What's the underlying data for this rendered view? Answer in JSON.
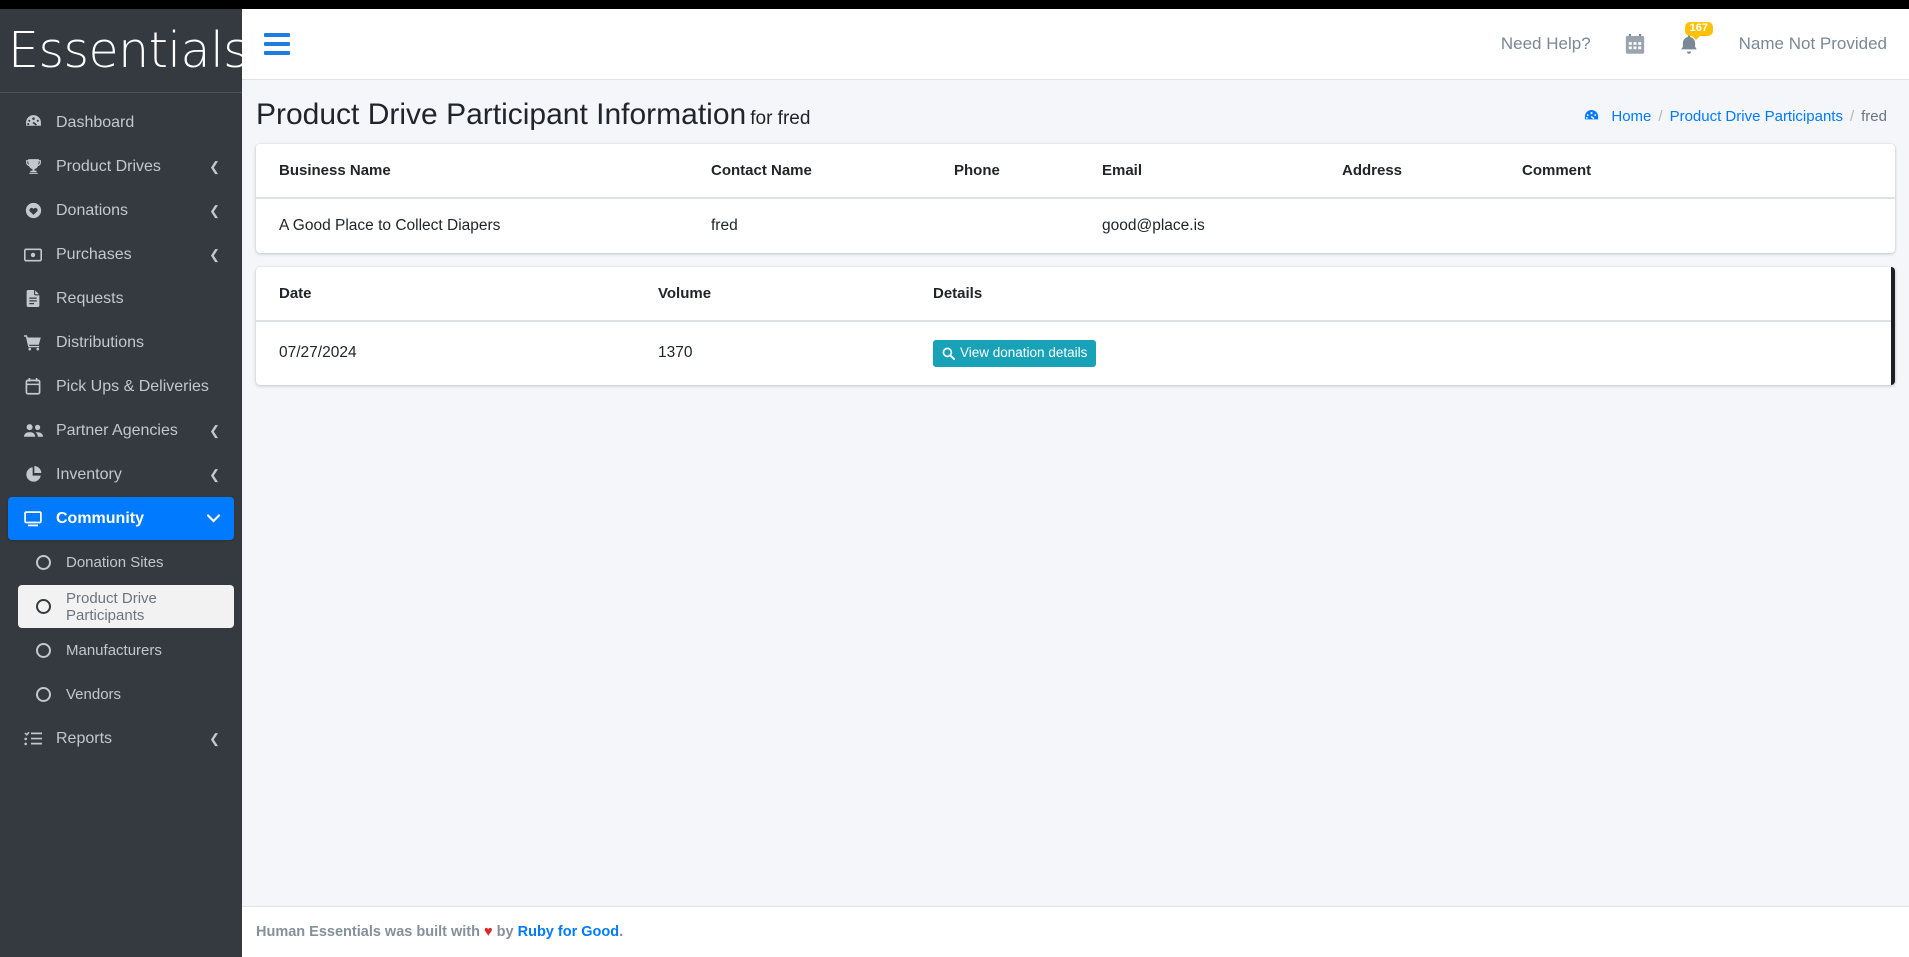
{
  "brand": {
    "name": "Essentials"
  },
  "sidebar": {
    "items": [
      {
        "label": "Dashboard",
        "icon": "dashboard-icon",
        "caret": false,
        "state": "normal"
      },
      {
        "label": "Product Drives",
        "icon": "trophy-icon",
        "caret": true,
        "state": "normal"
      },
      {
        "label": "Donations",
        "icon": "heart-circle-icon",
        "caret": true,
        "state": "normal"
      },
      {
        "label": "Purchases",
        "icon": "money-icon",
        "caret": true,
        "state": "normal"
      },
      {
        "label": "Requests",
        "icon": "document-icon",
        "caret": false,
        "state": "normal"
      },
      {
        "label": "Distributions",
        "icon": "cart-icon",
        "caret": false,
        "state": "normal"
      },
      {
        "label": "Pick Ups & Deliveries",
        "icon": "calendar-icon",
        "caret": false,
        "state": "normal"
      },
      {
        "label": "Partner Agencies",
        "icon": "users-icon",
        "caret": true,
        "state": "normal"
      },
      {
        "label": "Inventory",
        "icon": "pie-chart-icon",
        "caret": true,
        "state": "normal"
      },
      {
        "label": "Community",
        "icon": "desktop-icon",
        "caret": true,
        "state": "active"
      }
    ],
    "sub_items": [
      {
        "label": "Donation Sites",
        "icon": "circle-icon",
        "state": "normal"
      },
      {
        "label": "Product Drive Participants",
        "icon": "circle-icon",
        "state": "hovered"
      },
      {
        "label": "Manufacturers",
        "icon": "circle-icon",
        "state": "normal"
      },
      {
        "label": "Vendors",
        "icon": "circle-icon",
        "state": "normal"
      }
    ],
    "trailing_items": [
      {
        "label": "Reports",
        "icon": "list-check-icon",
        "caret": true,
        "state": "normal"
      }
    ],
    "caret_collapsed_glyph": "❮",
    "caret_expanded_glyph": "❯"
  },
  "navbar": {
    "menu_toggle": "hamburger-icon",
    "help_label": "Need Help?",
    "calendar_icon": "calendar-icon",
    "notifications_icon": "bell-icon",
    "notifications_count": "167",
    "user_label": "Name Not Provided"
  },
  "page": {
    "title": "Product Drive Participant Information",
    "title_suffix": "for fred",
    "breadcrumb": {
      "home": "Home",
      "section": "Product Drive Participants",
      "current": "fred",
      "separator": "/"
    }
  },
  "participant_table": {
    "headers": [
      "Business Name",
      "Contact Name",
      "Phone",
      "Email",
      "Address",
      "Comment"
    ],
    "rows": [
      {
        "business_name": "A Good Place to Collect Diapers",
        "contact_name": "fred",
        "phone": "",
        "email": "good@place.is",
        "address": "",
        "comment": ""
      }
    ]
  },
  "donations_table": {
    "headers": [
      "Date",
      "Volume",
      "Details"
    ],
    "rows": [
      {
        "date": "07/27/2024",
        "volume": "1370",
        "details_button": "View donation details"
      }
    ]
  },
  "footer": {
    "prefix": "Human Essentials was built with",
    "heart": "♥",
    "middle": "by",
    "link": "Ruby for Good",
    "suffix": "."
  },
  "colors": {
    "sidebar_bg": "#343a40",
    "accent_blue": "#007bff",
    "teal_button": "#17a2b8",
    "badge_yellow": "#ffc107",
    "content_bg": "#f4f6f9"
  }
}
